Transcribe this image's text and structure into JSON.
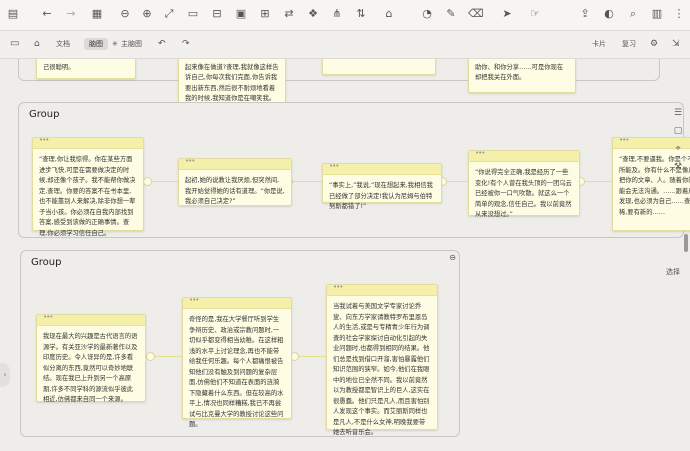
{
  "toolbar": {
    "views": {
      "doc": "文档",
      "outline": "脑图",
      "theme": "主脑图"
    },
    "right": {
      "card": "卡片",
      "review": "复习"
    }
  },
  "canvas": {
    "top_cards": [
      {
        "text": "在日那段日,每个人都曾觉得自己很聪明。"
      },
      {
        "text": "是查理继承式的快速进步,让你看起来像在做道?查理,我就像这样告诉自己,你每次我们完面,你告诉我要出新东西,然后很不耐烦地看着我的时候,我知道你是在嘲笑我。"
      },
      {
        "text": "的转变。"
      },
      {
        "text": "我希望你的智慧都来收高,愿意协助你、和你分享……可是你现在却把我关在外面。"
      }
    ],
    "groups": [
      {
        "title": "Group",
        "cards": [
          {
            "text": "“查理,你让我惊得。你在某些方面进步飞快,可是在需要做决定的时候,却还像个孩子。我不能帮你做决定,查理。你要的答案不在书本里,也不能靠别人来解决,除非你想一辈子当小孩。你必须在自我内部找到答案,感受到该做的正确事情。查理,你必须学习信任自己。"
          },
          {
            "text": "起初,她的说教让我厌烦,但突然间,我开始觉得她的话有道理。“你是说,我必须自己决定?”"
          },
          {
            "text": "“事实上,”我说,“现在想起来,我相信我已经做了部分决定!我认为尼姆与伯特努斯都错了!”"
          },
          {
            "text": "“你说得完全正确,我是经历了一些变化!有个人曾在我头顶的一团乌云已经被你一口气吹散。就这么一个简单的观念,信任自己。我以前竟然从来没想过。”"
          },
          {
            "text": "“查理,不要逼我。你是个不是我的智慧所能及。你有什么不是像月甚至几星期,把你的文章、人。随着你的智慧,我的可能会无法沟通。……跟着成熟,你甚至会发现,也必须为自己……查理。”每次都稀,要有新的……"
          }
        ]
      },
      {
        "title": "Group",
        "cards": [
          {
            "text": "我现在最大的兴趣是古代语言的语源学。有关亚沙学的最新著作以及印度历史。令人讶异的是,许多看似分离的东西,竟然可以奇妙地联结。现在我已上升到另一个高原期,许多不同学科的源流似乎彼此相近,仿佛都来自同一个来源。"
          },
          {
            "text": "奇怪的是,我在大学餐厅听到学生争辩历史、政治或宗教问题时,一切似乎都变得相当幼稚。在这样粗浅的水平上讨论理念,再也不能带给我任何乐趣。每个人都痛恨被告知他们没有触及到问题的复杂层面,仿佛他们不知道在表面的涟漪下隐藏着什么东西。但在较高的水平上,情况也同样糟糕,我已不再尝试与比克曼大学的教授讨论这些问题。"
          },
          {
            "text": "当我试着与美国文学专家讨论乔叟、向东方学家请教特罗布里恩岛人的生活,或是与专精青少年行为调查的社会学家探讨自动化引起的失业问题时,也都得到相同的结果。他们总是找到借口开溜,害怕暴露他们知识范围的狭窄。如今,他们在我眼中的地位已全然不同。我以前竟然以为教授都是智识上的巨人,这实在很愚蠢。他们只是凡人,而且害怕别人发现这个事实。而艾丽斯同样也是凡人,不是什么女神,明晚我要带她去听音乐会。"
          }
        ]
      }
    ]
  },
  "sidebar_right": {
    "select_label": "选择"
  }
}
